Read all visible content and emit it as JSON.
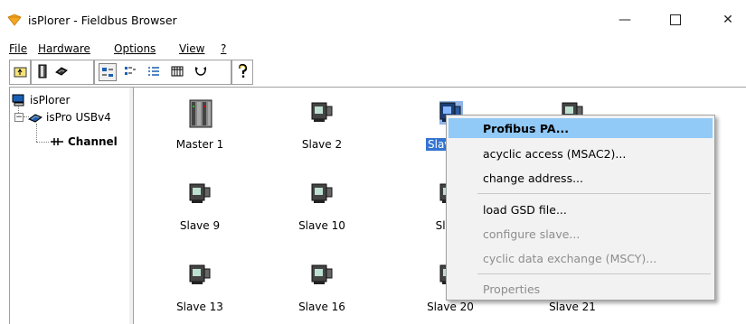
{
  "window": {
    "title": "isPlorer - Fieldbus Browser",
    "minimize": "—",
    "close": "✕"
  },
  "menu": [
    "File",
    "Hardware",
    "Options",
    "View",
    "?"
  ],
  "tree": {
    "root": "isPlorer",
    "child": "isPro USBv4",
    "grandchild": "Channel"
  },
  "devices": [
    {
      "label": "Master 1",
      "type": "master"
    },
    {
      "label": "Slave 2",
      "type": "slave"
    },
    {
      "label": "Slav",
      "type": "slave-selected"
    },
    {
      "label": "",
      "type": "slave"
    },
    {
      "label": "Slave 9",
      "type": "slave"
    },
    {
      "label": "Slave 10",
      "type": "slave"
    },
    {
      "label": "Slave",
      "type": "slave"
    },
    {
      "label": "Slave 13",
      "type": "slave"
    },
    {
      "label": "Slave 16",
      "type": "slave"
    },
    {
      "label": "Slave 20",
      "type": "slave"
    },
    {
      "label": "Slave 21",
      "type": "slave"
    }
  ],
  "context_menu": {
    "items": [
      {
        "label": "Profibus PA...",
        "bold": true,
        "highlighted": true,
        "enabled": true
      },
      {
        "label": "acyclic access (MSAC2)...",
        "enabled": true
      },
      {
        "label": "change address...",
        "enabled": true
      },
      {
        "label": "load GSD file...",
        "enabled": true
      },
      {
        "label": "configure slave...",
        "enabled": false
      },
      {
        "label": "cyclic data exchange (MSCY)...",
        "enabled": false
      },
      {
        "label": "Properties",
        "enabled": false
      }
    ]
  },
  "colors": {
    "selection": "#3374d0",
    "menu_highlight": "#91c9f7",
    "disabled_text": "#8d8d8d"
  }
}
